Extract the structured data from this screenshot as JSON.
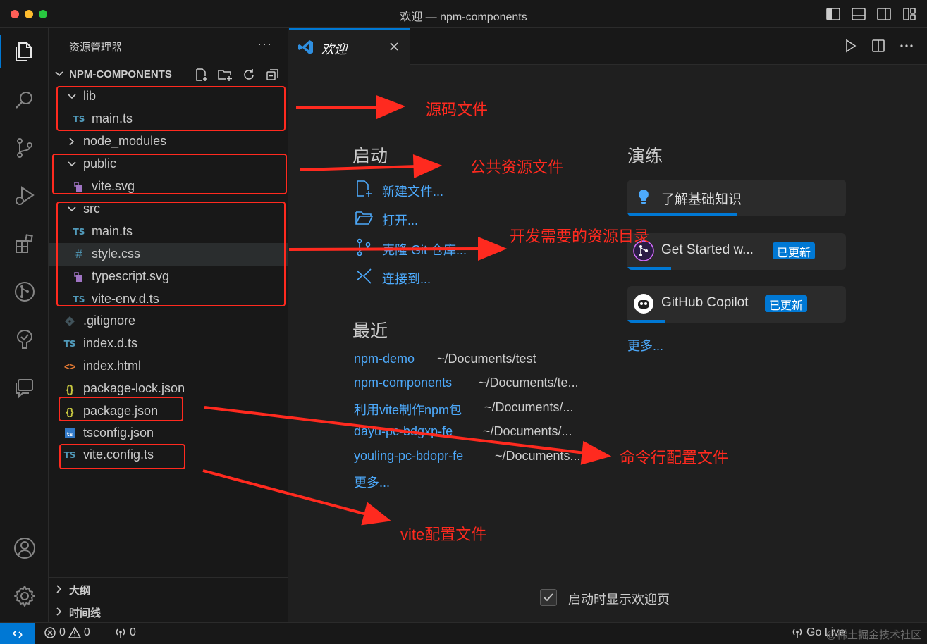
{
  "window": {
    "title": "欢迎 — npm-components"
  },
  "sidebar": {
    "title": "资源管理器",
    "more": "···",
    "project": "NPM-COMPONENTS",
    "tree": [
      {
        "label": "lib",
        "type": "folder",
        "open": true,
        "depth": 1
      },
      {
        "label": "main.ts",
        "type": "ts",
        "depth": 2
      },
      {
        "label": "node_modules",
        "type": "folder",
        "open": false,
        "depth": 1
      },
      {
        "label": "public",
        "type": "folder",
        "open": true,
        "depth": 1
      },
      {
        "label": "vite.svg",
        "type": "svg",
        "depth": 2
      },
      {
        "label": "src",
        "type": "folder",
        "open": true,
        "depth": 1
      },
      {
        "label": "main.ts",
        "type": "ts",
        "depth": 2
      },
      {
        "label": "style.css",
        "type": "css",
        "depth": 2
      },
      {
        "label": "typescript.svg",
        "type": "svg",
        "depth": 2
      },
      {
        "label": "vite-env.d.ts",
        "type": "ts",
        "depth": 2
      },
      {
        "label": ".gitignore",
        "type": "git",
        "depth": 1
      },
      {
        "label": "index.d.ts",
        "type": "ts",
        "depth": 1
      },
      {
        "label": "index.html",
        "type": "html",
        "depth": 1
      },
      {
        "label": "package-lock.json",
        "type": "json",
        "depth": 1
      },
      {
        "label": "package.json",
        "type": "json",
        "depth": 1
      },
      {
        "label": "tsconfig.json",
        "type": "tsconfig",
        "depth": 1
      },
      {
        "label": "vite.config.ts",
        "type": "ts",
        "depth": 1
      }
    ],
    "outline": "大纲",
    "timeline": "时间线"
  },
  "editor": {
    "tab_label": "欢迎",
    "start": {
      "heading": "启动",
      "items": [
        "新建文件...",
        "打开...",
        "克隆 Git 仓库...",
        "连接到..."
      ]
    },
    "recent": {
      "heading": "最近",
      "items": [
        {
          "name": "npm-demo",
          "path": "~/Documents/test"
        },
        {
          "name": "npm-components",
          "path": "~/Documents/te..."
        },
        {
          "name": "利用vite制作npm包",
          "path": "~/Documents/..."
        },
        {
          "name": "dayu-pc-bdgxp-fe",
          "path": "~/Documents/..."
        },
        {
          "name": "youling-pc-bdopr-fe",
          "path": "~/Documents..."
        }
      ],
      "more": "更多..."
    },
    "walkthroughs": {
      "heading": "演练",
      "items": [
        {
          "title": "了解基础知识",
          "badge": "",
          "progress": 0.5
        },
        {
          "title": "Get Started w...",
          "badge": "已更新",
          "progress": 0.2
        },
        {
          "title": "GitHub Copilot",
          "badge": "已更新",
          "progress": 0.17
        }
      ],
      "more": "更多..."
    },
    "show_on_startup": "启动时显示欢迎页"
  },
  "statusbar": {
    "errors": "0",
    "warnings": "0",
    "ports": "0",
    "go_live": "Go Live",
    "watermark": "@稀土掘金技术社区"
  },
  "annotations": [
    "源码文件",
    "公共资源文件",
    "开发需要的资源目录",
    "命令行配置文件",
    "vite配置文件"
  ],
  "colors": {
    "accent": "#0078d4",
    "link": "#4daafc",
    "annotation": "#ff2a1f",
    "background": "#1f1f1f"
  }
}
